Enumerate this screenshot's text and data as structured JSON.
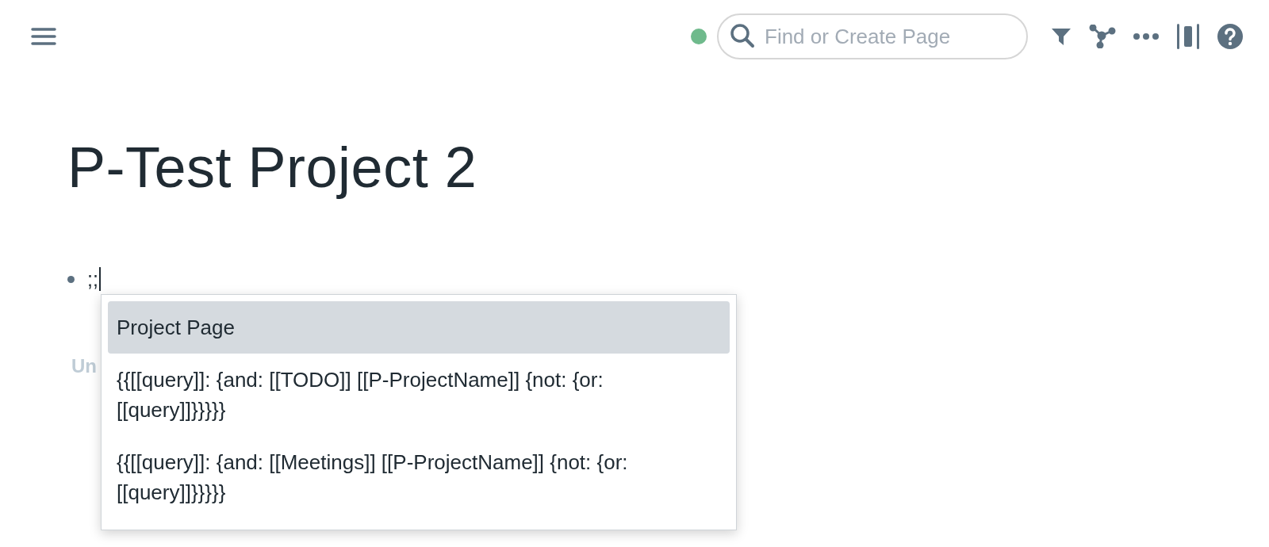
{
  "topbar": {
    "sync_status": {
      "color": "#6fba8c"
    },
    "search": {
      "placeholder": "Find or Create Page"
    }
  },
  "page": {
    "title": "P-Test Project 2",
    "blocks": [
      {
        "text": ";;"
      }
    ],
    "references_heading": "Un"
  },
  "autocomplete": {
    "items": [
      {
        "text": "Project Page",
        "selected": true
      },
      {
        "text": "{{[[query]]: {and: [[TODO]] [[P-ProjectName]] {not: {or: [[query]]}}}}}",
        "selected": false
      },
      {
        "text": "{{[[query]]: {and: [[Meetings]] [[P-ProjectName]] {not: {or: [[query]]}}}}}",
        "selected": false
      }
    ]
  }
}
